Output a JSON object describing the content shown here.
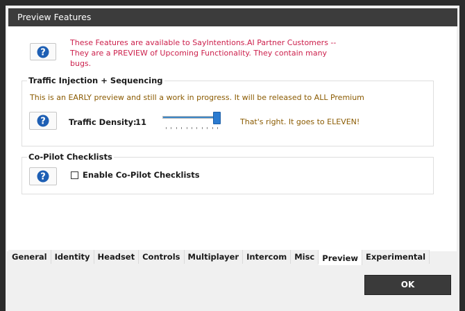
{
  "window": {
    "title": "Preview Features"
  },
  "intro": {
    "text": "These Features are available to SayIntentions.AI Partner Customers -- They are a PREVIEW of Upcoming Functionality. They contain many bugs."
  },
  "traffic": {
    "group_title": "Traffic Injection + Sequencing",
    "early_text": "This is an EARLY preview and still a work in progress. It will be released to ALL Premium",
    "density_label": "Traffic Density:",
    "density_value": "11",
    "density_level": 11,
    "density_max": 11,
    "eleven_text": "That's right. It goes to ELEVEN!"
  },
  "copilot": {
    "group_title": "Co-Pilot Checklists",
    "checkbox_label": "Enable Co-Pilot Checklists",
    "checked": false
  },
  "tabs": [
    {
      "label": "General",
      "active": false
    },
    {
      "label": "Identity",
      "active": false
    },
    {
      "label": "Headset",
      "active": false
    },
    {
      "label": "Controls",
      "active": false
    },
    {
      "label": "Multiplayer",
      "active": false
    },
    {
      "label": "Intercom",
      "active": false
    },
    {
      "label": "Misc",
      "active": false
    },
    {
      "label": "Preview",
      "active": true
    },
    {
      "label": "Experimental",
      "active": false
    }
  ],
  "ok_button": {
    "label": "OK"
  },
  "colors": {
    "intro_text": "#cc1f4b",
    "notice_text": "#8a5a00",
    "help_icon": "#1e5fb4",
    "slider_thumb": "#2b7bd0"
  },
  "icons": {
    "help": "question-circle-icon"
  }
}
